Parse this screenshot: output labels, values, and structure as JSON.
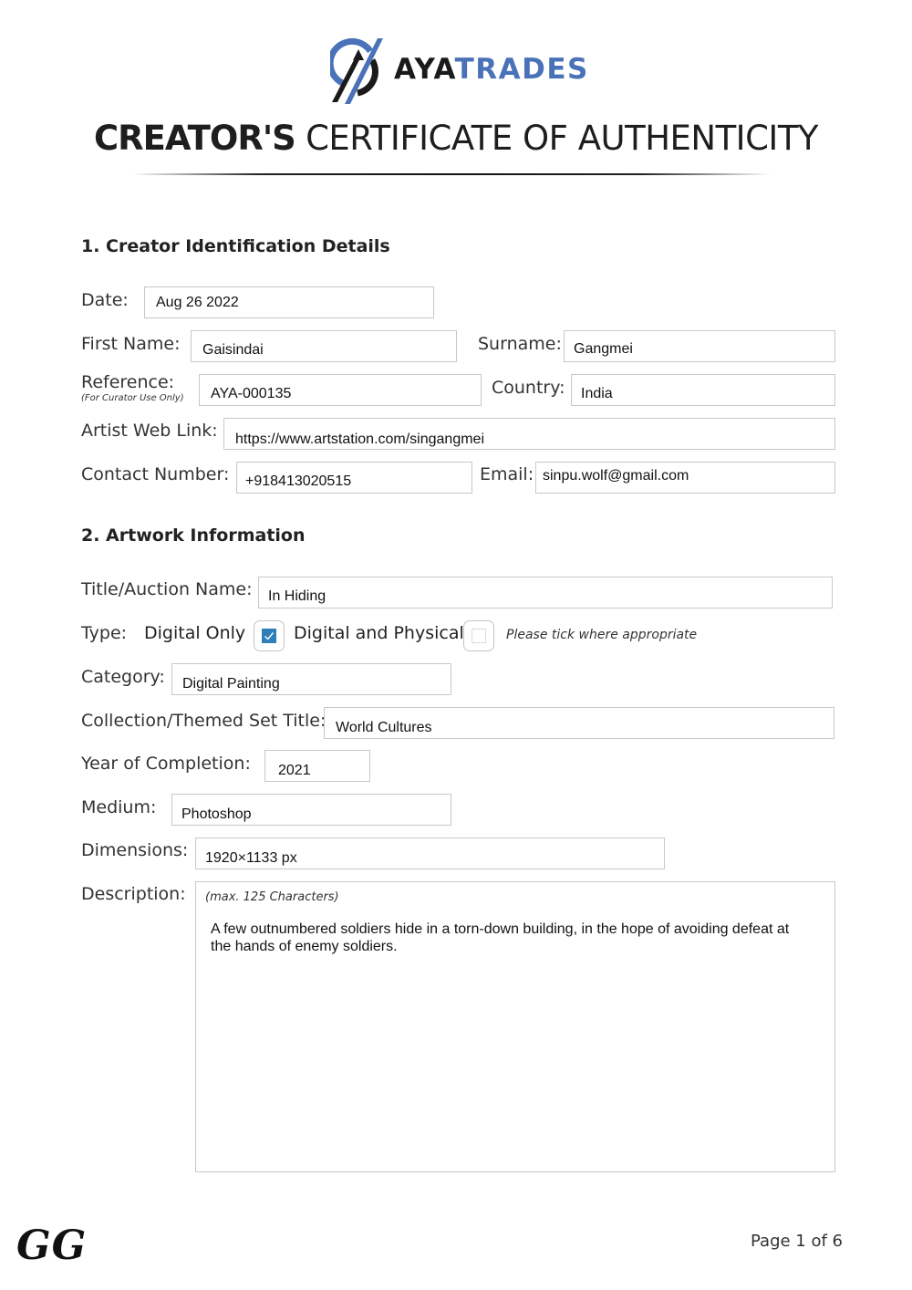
{
  "brand": {
    "logo_icon": "ayatrades-logo-icon",
    "name_dark": "AYA",
    "name_blue": "TRADES",
    "colors": {
      "blue": "#4a72b8",
      "dark": "#1a1a1a",
      "checkbox_checked": "#2f80b9"
    }
  },
  "document": {
    "title_bold": "CREATOR'S",
    "title_light": "CERTIFICATE OF AUTHENTICITY"
  },
  "section1": {
    "heading": "1. Creator Identification Details",
    "date": {
      "label": "Date:",
      "value": "Aug 26 2022"
    },
    "first_name": {
      "label": "First Name:",
      "value": "Gaisindai"
    },
    "surname": {
      "label": "Surname:",
      "value": "Gangmei"
    },
    "reference": {
      "label": "Reference:",
      "sublabel": "(For Curator Use Only)",
      "value": "AYA-000135"
    },
    "country": {
      "label": "Country:",
      "value": "India"
    },
    "web_link": {
      "label": "Artist Web Link:",
      "value": "https://www.artstation.com/singangmei"
    },
    "contact": {
      "label": "Contact Number:",
      "value": "+918413020515"
    },
    "email": {
      "label": "Email:",
      "value": "sinpu.wolf@gmail.com"
    }
  },
  "section2": {
    "heading": "2. Artwork Information",
    "title": {
      "label": "Title/Auction Name:",
      "value": "In Hiding"
    },
    "type": {
      "label": "Type:",
      "options": [
        {
          "label": "Digital Only",
          "checked": true,
          "icon": "checkmark-icon"
        },
        {
          "label": "Digital and Physical",
          "checked": false
        }
      ],
      "hint": "Please tick where appropriate"
    },
    "category": {
      "label": "Category:",
      "value": "Digital Painting"
    },
    "collection": {
      "label": "Collection/Themed Set Title:",
      "value": "World Cultures"
    },
    "year": {
      "label": "Year of Completion:",
      "value": "2021"
    },
    "medium": {
      "label": "Medium:",
      "value": "Photoshop"
    },
    "dimensions": {
      "label": "Dimensions:",
      "value": "1920×1133 px"
    },
    "description": {
      "label": "Description:",
      "hint": "(max. 125 Characters)",
      "value": "A few outnumbered soldiers hide in a torn-down building, in the hope of avoiding defeat at the hands of enemy soldiers."
    }
  },
  "footer": {
    "signature": "GG",
    "page": "Page 1 of 6"
  }
}
